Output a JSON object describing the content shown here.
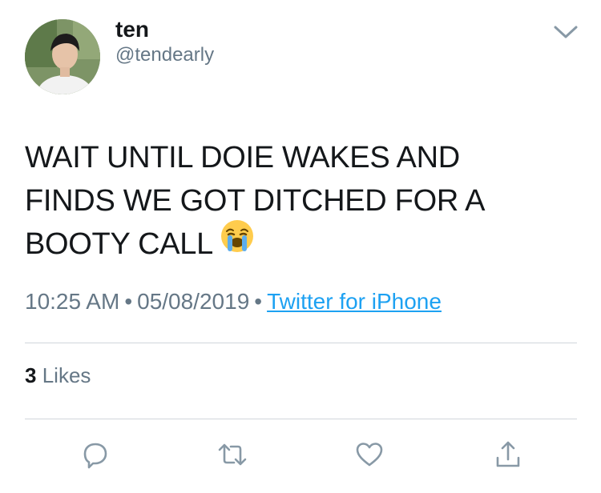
{
  "user": {
    "name": "ten",
    "handle": "@tendearly"
  },
  "tweet": {
    "lines": [
      "WAIT UNTIL DOIE WAKES AND",
      "FINDS WE GOT DITCHED FOR A",
      "BOOTY CALL"
    ],
    "emoji": "loudly-crying-face"
  },
  "meta": {
    "time": "10:25 AM",
    "separator": "•",
    "date": "05/08/2019",
    "source": "Twitter for iPhone"
  },
  "stats": {
    "likes_count": "3",
    "likes_label": "Likes"
  },
  "actions": {
    "reply_icon": "reply-icon",
    "retweet_icon": "retweet-icon",
    "like_icon": "heart-icon",
    "share_icon": "share-icon"
  },
  "colors": {
    "text": "#14171a",
    "muted": "#657786",
    "link": "#1da1f2",
    "icon": "#8899a6",
    "divider": "#d0d6db"
  }
}
